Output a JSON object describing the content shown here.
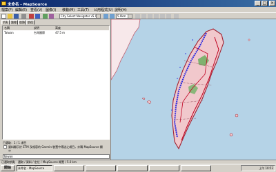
{
  "window": {
    "title": "未命名 - MapSource"
  },
  "menu": [
    "檔案(F)",
    "編輯(E)",
    "查看(V)",
    "圖像(I)",
    "移動(M)",
    "工具(T)",
    "公用程式(U)",
    "說明(H)"
  ],
  "toolbar": {
    "map_product": "City Select Navigator v5.00",
    "zoom": "5.0km"
  },
  "tabs": [
    "航點",
    "路線",
    "航跡",
    "航徑"
  ],
  "waypoint_list": {
    "columns": [
      "名稱",
      "說明",
      "高度"
    ],
    "rows": [
      {
        "name": "Taiwan",
        "desc": "台灣國際",
        "alt": "47.5 m"
      }
    ]
  },
  "selected_info": "已選取：1 / 1 項目",
  "checkbox_text": "資料顯示於 ETM 及相容的 Garmin 裝置中傳送之項目，亦稱 MapSource 顯示",
  "bottom_field": "Taiwan",
  "status_text": "已選取航點　選取 / 資料 / 定位 / MapSource 概覽 / 5.0 km",
  "taskbar": {
    "start": "開始",
    "tasks": [
      "未命名 - MapSource",
      "",
      "",
      "",
      "",
      ""
    ],
    "clock": "上午 10:52"
  }
}
